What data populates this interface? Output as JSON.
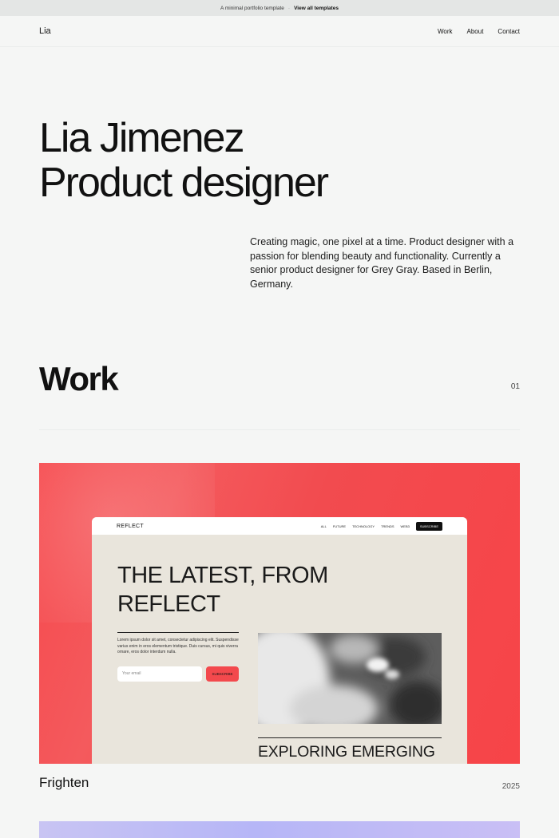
{
  "topbar": {
    "text": "A minimal portfolio template",
    "separator": "·",
    "link": "View all templates"
  },
  "nav": {
    "logo": "Lia",
    "links": [
      "Work",
      "About",
      "Contact"
    ]
  },
  "hero": {
    "line1": "Lia Jimenez",
    "line2": "Product designer"
  },
  "intro": "Creating magic, one pixel at a time. Product designer with a passion for blending beauty and functionality. Currently a senior product designer for Grey Gray. Based in Berlin, Germany.",
  "work": {
    "title": "Work",
    "number": "01"
  },
  "project1": {
    "name": "Frighten",
    "year": "2025",
    "accent": "#f6494d",
    "mock": {
      "logo": "REFLECT",
      "links": [
        "ALL",
        "FUTURE",
        "TECHNOLOGY",
        "TRENDS",
        "WEB3"
      ],
      "subscribe": "SUBSCRIBE",
      "headline_line1": "THE LATEST, FROM",
      "headline_line2": "REFLECT",
      "body": "Lorem ipsum dolor sit amet, consectetur adipiscing elit. Suspendisse varius enim in eros elementum tristique. Duis cursus, mi quis viverra ornare, eros dolor interdum nulla.",
      "email_placeholder": "Your email",
      "button": "SUBSCRIBE",
      "headline2": "EXPLORING EMERGING"
    }
  },
  "project2": {
    "accent": "#b6b6f7"
  }
}
